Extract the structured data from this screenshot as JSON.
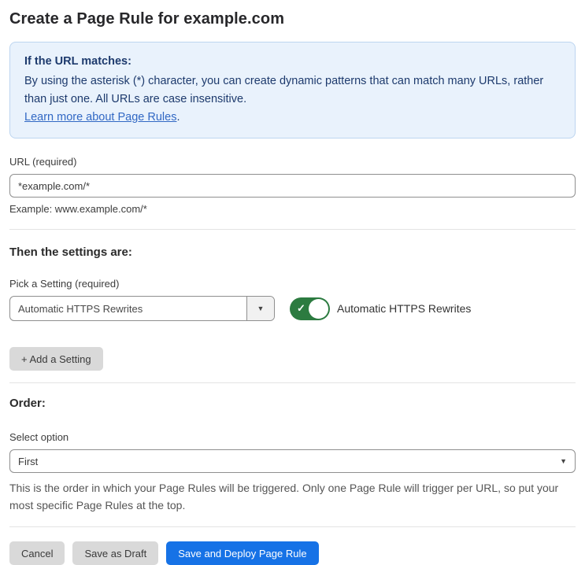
{
  "page": {
    "title": "Create a Page Rule for example.com"
  },
  "info_box": {
    "heading": "If the URL matches:",
    "body": "By using the asterisk (*) character, you can create dynamic patterns that can match many URLs, rather than just one. All URLs are case insensitive.",
    "link_label": "Learn more about Page Rules",
    "link_suffix": "."
  },
  "url_field": {
    "label": "URL (required)",
    "value": "*example.com/*",
    "hint": "Example: www.example.com/*"
  },
  "settings_section": {
    "heading": "Then the settings are:",
    "picker_label": "Pick a Setting (required)",
    "picker_value": "Automatic HTTPS Rewrites",
    "toggle_state": "on",
    "toggle_label": "Automatic HTTPS Rewrites",
    "add_setting_label": "+ Add a Setting"
  },
  "order_section": {
    "heading": "Order:",
    "select_label": "Select option",
    "select_value": "First",
    "hint": "This is the order in which your Page Rules will be triggered. Only one Page Rule will trigger per URL, so put your most specific Page Rules at the top."
  },
  "footer": {
    "cancel_label": "Cancel",
    "save_draft_label": "Save as Draft",
    "save_deploy_label": "Save and Deploy Page Rule"
  },
  "icons": {
    "check": "✓",
    "chevron_down": "▼"
  },
  "colors": {
    "info_bg": "#e9f2fc",
    "info_border": "#bcd5f0",
    "info_text": "#1d3a6d",
    "link": "#3168c4",
    "toggle_on": "#2c7b40",
    "primary_button": "#1672e6",
    "gray_button": "#d9d9d9"
  }
}
